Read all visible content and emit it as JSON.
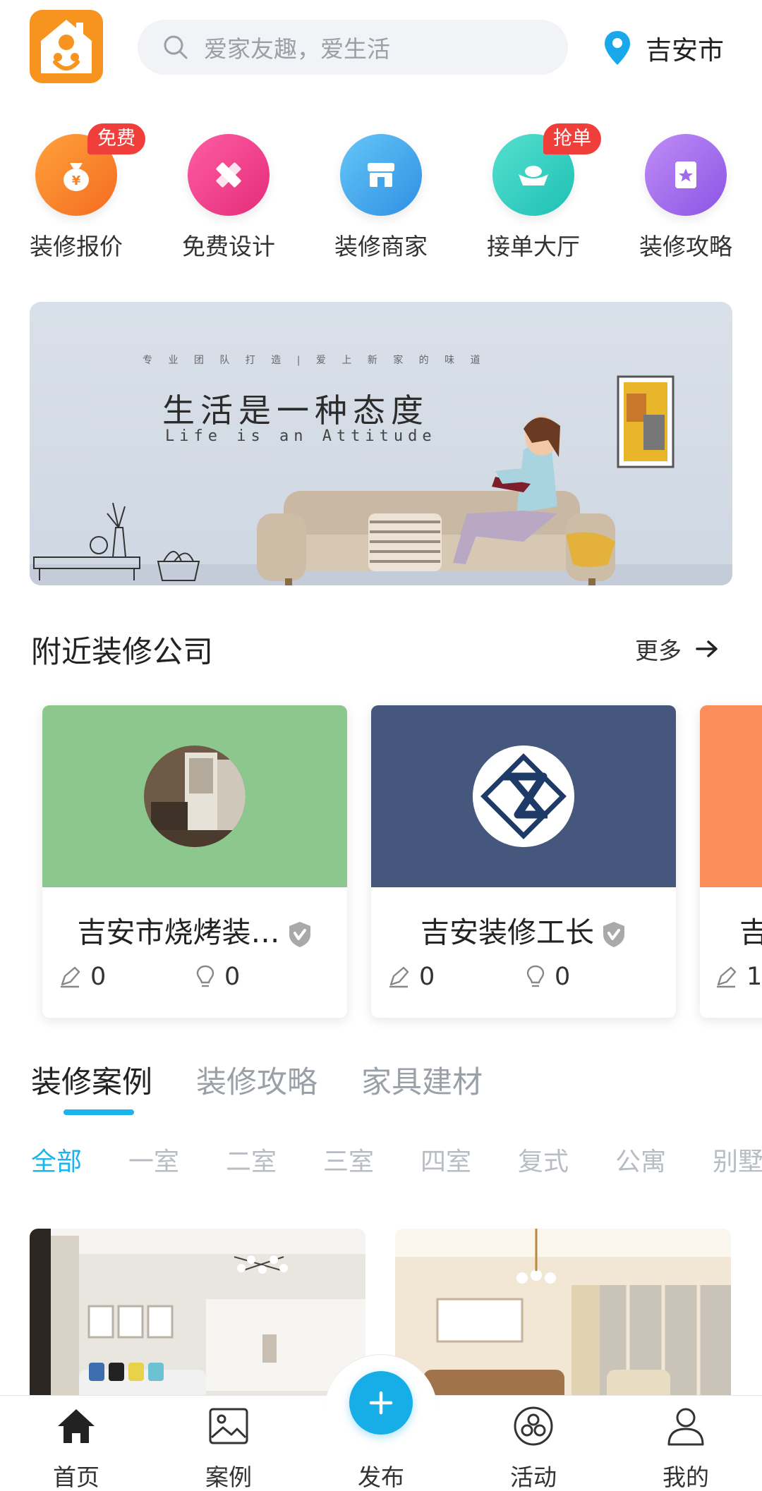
{
  "header": {
    "search_placeholder": "爱家友趣，爱生活",
    "city": "吉安市"
  },
  "quick_entries": [
    {
      "label": "装修报价",
      "badge": "免费",
      "icon": "money-bag-icon",
      "color": "#f6822a"
    },
    {
      "label": "免费设计",
      "badge": "",
      "icon": "pencil-ruler-icon",
      "color": "#ef3f8c"
    },
    {
      "label": "装修商家",
      "badge": "",
      "icon": "store-icon",
      "color": "#3ea7ec"
    },
    {
      "label": "接单大厅",
      "badge": "抢单",
      "icon": "ingot-icon",
      "color": "#27cfc1"
    },
    {
      "label": "装修攻略",
      "badge": "",
      "icon": "star-bookmark-icon",
      "color": "#a06bea"
    }
  ],
  "banner": {
    "tagline": "专 业 团 队 打 造 | 爱 上 新 家 的 味 道",
    "title": "生活是一种态度",
    "subtitle": "Life is an Attitude"
  },
  "nearby": {
    "title": "附近装修公司",
    "more": "更多",
    "companies": [
      {
        "name": "吉安市烧烤装…",
        "cases": "0",
        "tips": "0",
        "color": "#8cc88e"
      },
      {
        "name": "吉安装修工长",
        "cases": "0",
        "tips": "0",
        "color": "#45577d"
      },
      {
        "name": "吉",
        "cases": "1",
        "tips": "",
        "color": "#fa8d59"
      }
    ]
  },
  "tabs": [
    "装修案例",
    "装修攻略",
    "家具建材"
  ],
  "filters": [
    "全部",
    "一室",
    "二室",
    "三室",
    "四室",
    "复式",
    "公寓",
    "别墅"
  ],
  "bottom_nav": [
    {
      "label": "首页",
      "icon": "home-icon"
    },
    {
      "label": "案例",
      "icon": "image-icon"
    },
    {
      "label": "发布",
      "icon": "plus-icon"
    },
    {
      "label": "活动",
      "icon": "activity-icon"
    },
    {
      "label": "我的",
      "icon": "user-icon"
    }
  ],
  "colors": {
    "accent": "#1bb4ec",
    "badge": "#f03f3a"
  }
}
